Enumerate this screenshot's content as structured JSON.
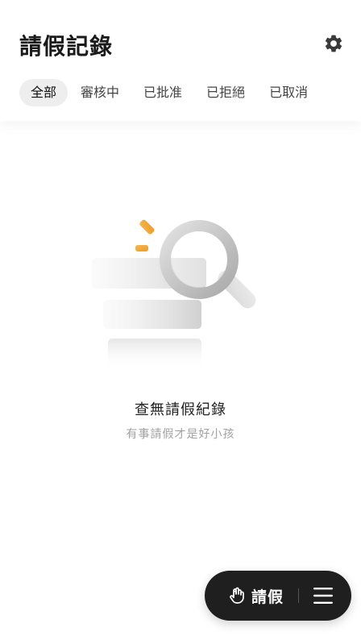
{
  "header": {
    "title": "請假記錄",
    "settings_icon": "gear-icon"
  },
  "tabs": [
    {
      "label": "全部",
      "active": true
    },
    {
      "label": "審核中",
      "active": false
    },
    {
      "label": "已批准",
      "active": false
    },
    {
      "label": "已拒絕",
      "active": false
    },
    {
      "label": "已取消",
      "active": false
    }
  ],
  "empty_state": {
    "illustration_icon": "magnifier-empty-list-icon",
    "title": "查無請假紀錄",
    "subtitle": "有事請假才是好小孩"
  },
  "fab": {
    "leave_label": "請假",
    "leave_icon": "hand-icon",
    "menu_icon": "hamburger-menu-icon"
  },
  "colors": {
    "accent": "#f0a233",
    "fab_bg": "#1f1f1f",
    "active_tab_bg": "#eeeeee"
  }
}
